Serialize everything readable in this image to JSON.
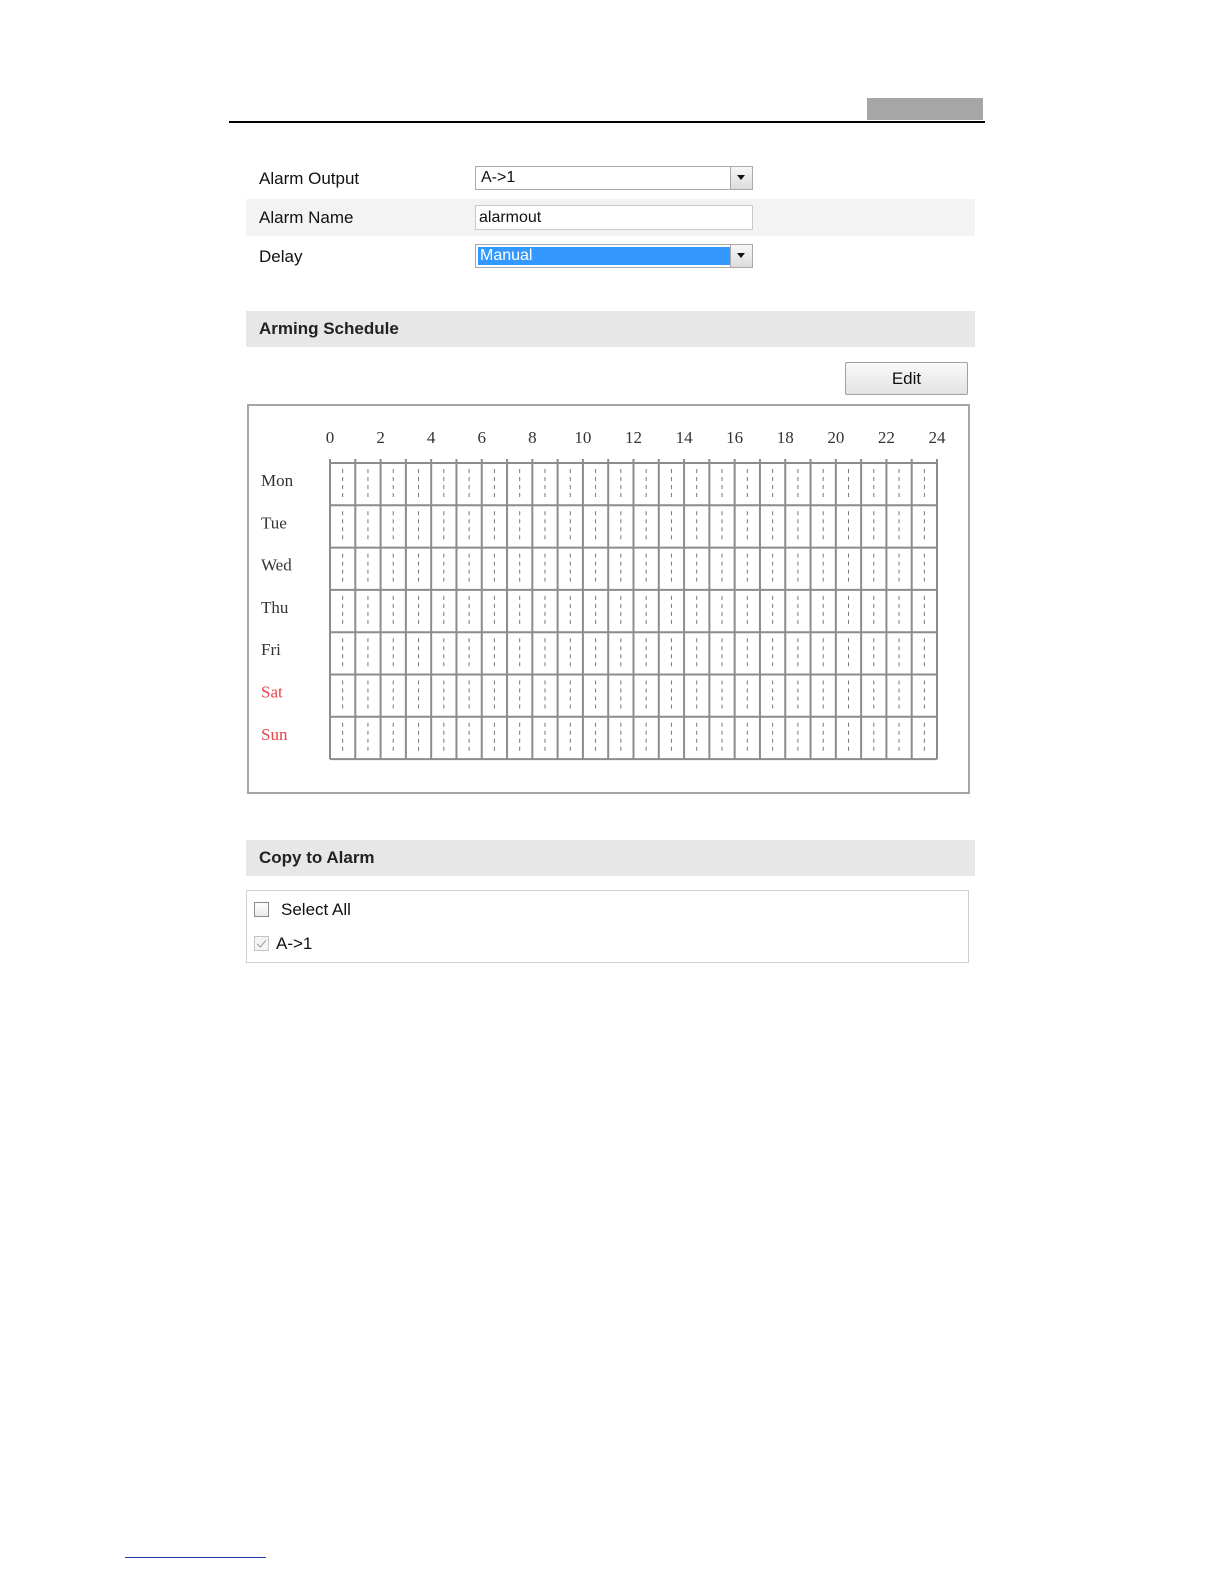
{
  "form": {
    "alarm_output": {
      "label": "Alarm Output",
      "value": "A->1"
    },
    "alarm_name": {
      "label": "Alarm Name",
      "value": "alarmout"
    },
    "delay": {
      "label": "Delay",
      "value": "Manual"
    }
  },
  "arming_schedule": {
    "title": "Arming Schedule",
    "edit_label": "Edit",
    "hour_labels": [
      "0",
      "2",
      "4",
      "6",
      "8",
      "10",
      "12",
      "14",
      "16",
      "18",
      "20",
      "22",
      "24"
    ],
    "days": [
      {
        "label": "Mon",
        "weekend": false
      },
      {
        "label": "Tue",
        "weekend": false
      },
      {
        "label": "Wed",
        "weekend": false
      },
      {
        "label": "Thu",
        "weekend": false
      },
      {
        "label": "Fri",
        "weekend": false
      },
      {
        "label": "Sat",
        "weekend": true
      },
      {
        "label": "Sun",
        "weekend": true
      }
    ],
    "colors": {
      "weekday": "#333333",
      "weekend": "#e8404a",
      "grid": "#8c8c8c"
    }
  },
  "copy_to_alarm": {
    "title": "Copy to Alarm",
    "select_all_label": "Select All",
    "select_all_checked": false,
    "items": [
      {
        "label": "A->1",
        "checked": true,
        "disabled": true
      }
    ]
  }
}
